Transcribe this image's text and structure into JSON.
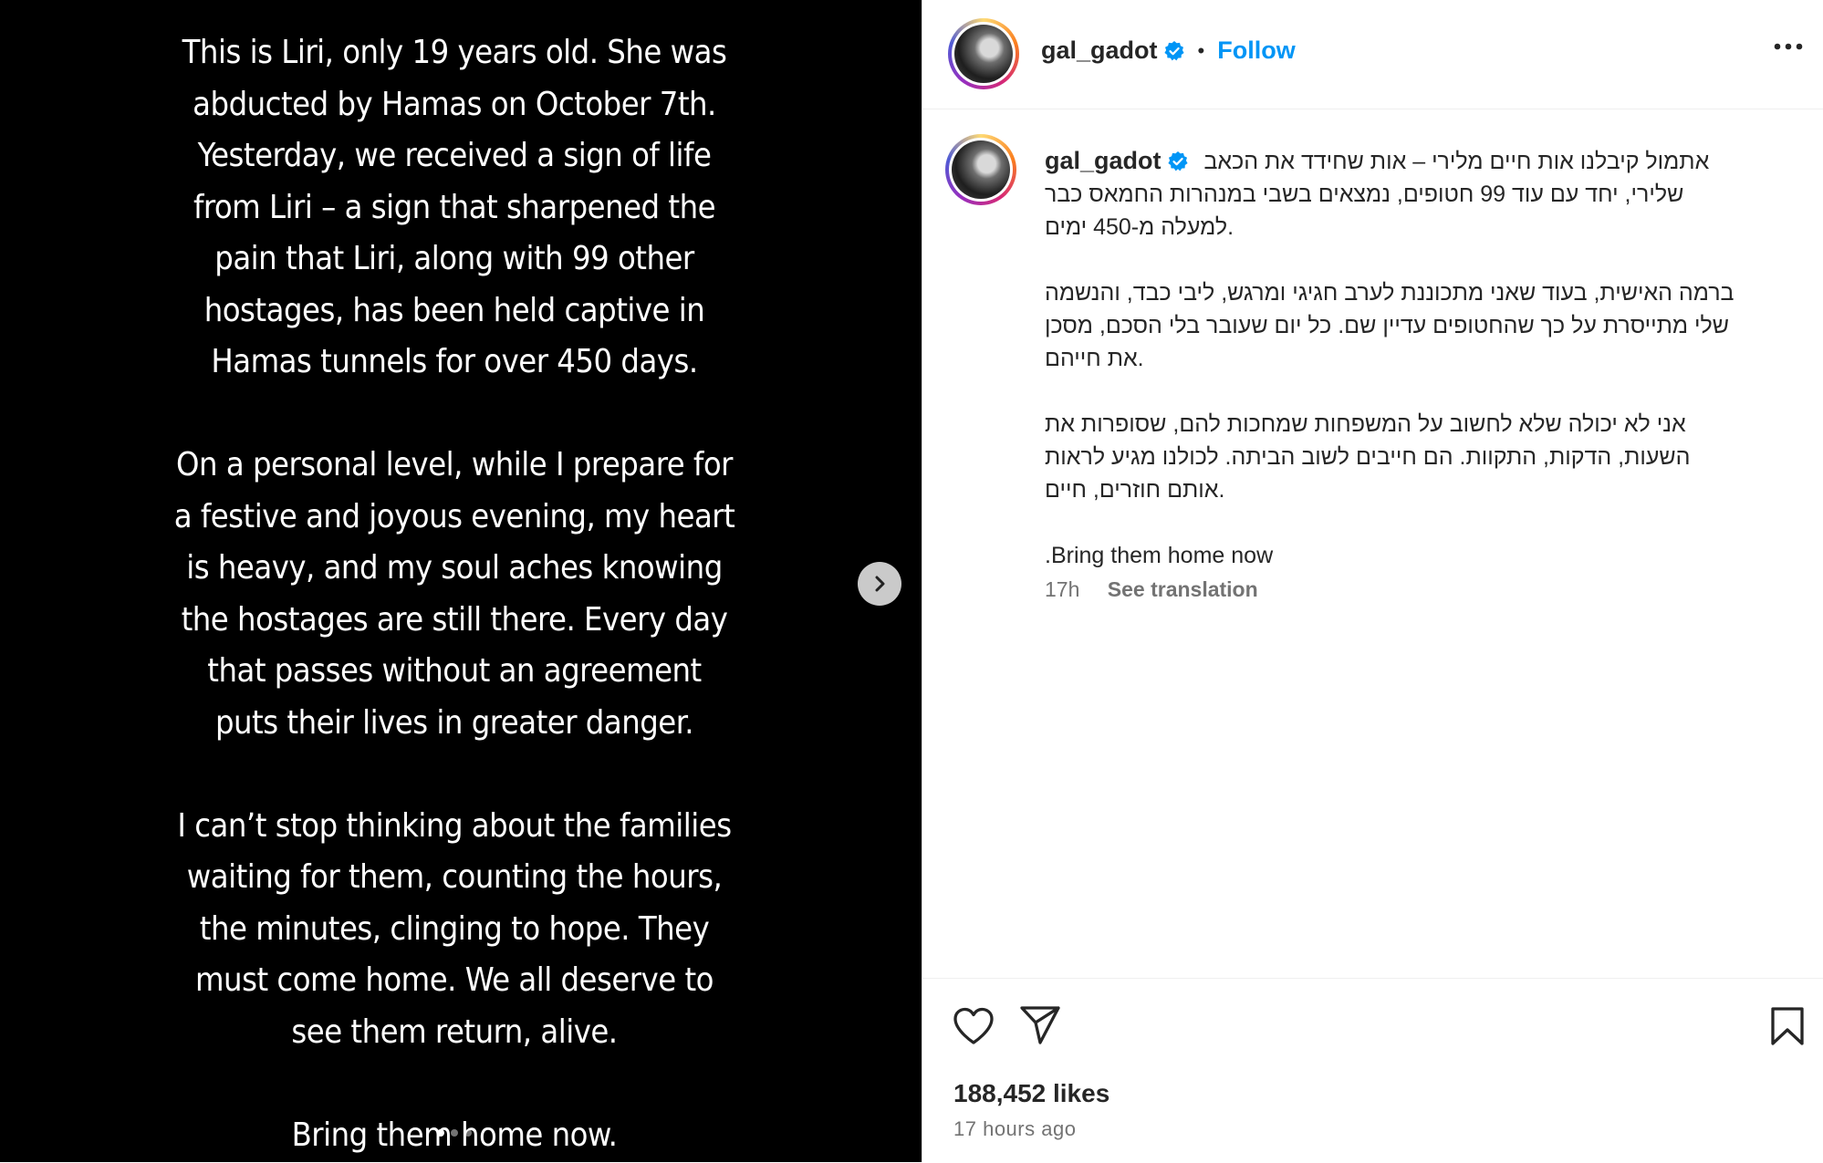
{
  "media": {
    "paragraphs": [
      "This is Liri, only 19 years old. She was\nabducted by Hamas on October 7th.\nYesterday, we received a sign of life\nfrom Liri – a sign that sharpened the\npain  that Liri, along with 99 other\nhostages, has been held captive in\nHamas tunnels for over 450 days.",
      "On a personal level, while I prepare for\na festive and joyous evening, my heart\nis heavy, and my soul aches knowing\nthe hostages are still there. Every day\nthat passes without an agreement\nputs their lives in greater danger.",
      "I can’t stop thinking about the families\nwaiting for them, counting the hours,\nthe minutes, clinging to hope. They\nmust come home. We all deserve to\nsee them return, alive.",
      "Bring them home now."
    ],
    "next_icon": "chevron-right-icon"
  },
  "post": {
    "username": "gal_gadot",
    "verified_icon": "verified-badge-icon",
    "separator": "•",
    "follow_label": "Follow",
    "more_icon": "more-horizontal-icon",
    "caption": {
      "username": "gal_gadot",
      "line1": "אתמול קיבלנו אות חיים מלירי – אות שחידד את הכאב",
      "line2": "שלירי, יחד עם עוד 99 חטופים, נמצאים בשבי במנהרות החמאס כבר",
      "line3": "למעלה מ-450 ימים.",
      "p2_line1": "ברמה האישית, בעוד שאני מתכוננת לערב חגיגי ומרגש, ליבי כבד, והנשמה",
      "p2_line2": "שלי מתייסרת על כך שהחטופים עדיין שם. כל יום שעובר בלי הסכם, מסכן",
      "p2_line3": "את חייהם.",
      "p3_line1": "אני לא יכולה שלא לחשוב על המשפחות שמחכות להם, שסופרות את",
      "p3_line2": "השעות, הדקות, התקוות. הם חייבים לשוב הביתה. לכולנו מגיע לראות",
      "p3_line3": "אותם חוזרים, חיים.",
      "p4": ".Bring them home now"
    },
    "time_short": "17h",
    "see_translation": "See translation",
    "likes": "188,452 likes",
    "time_ago": "17 hours ago",
    "colors": {
      "follow": "#0095f6",
      "verified": "#0095f6",
      "muted": "#737373"
    }
  }
}
